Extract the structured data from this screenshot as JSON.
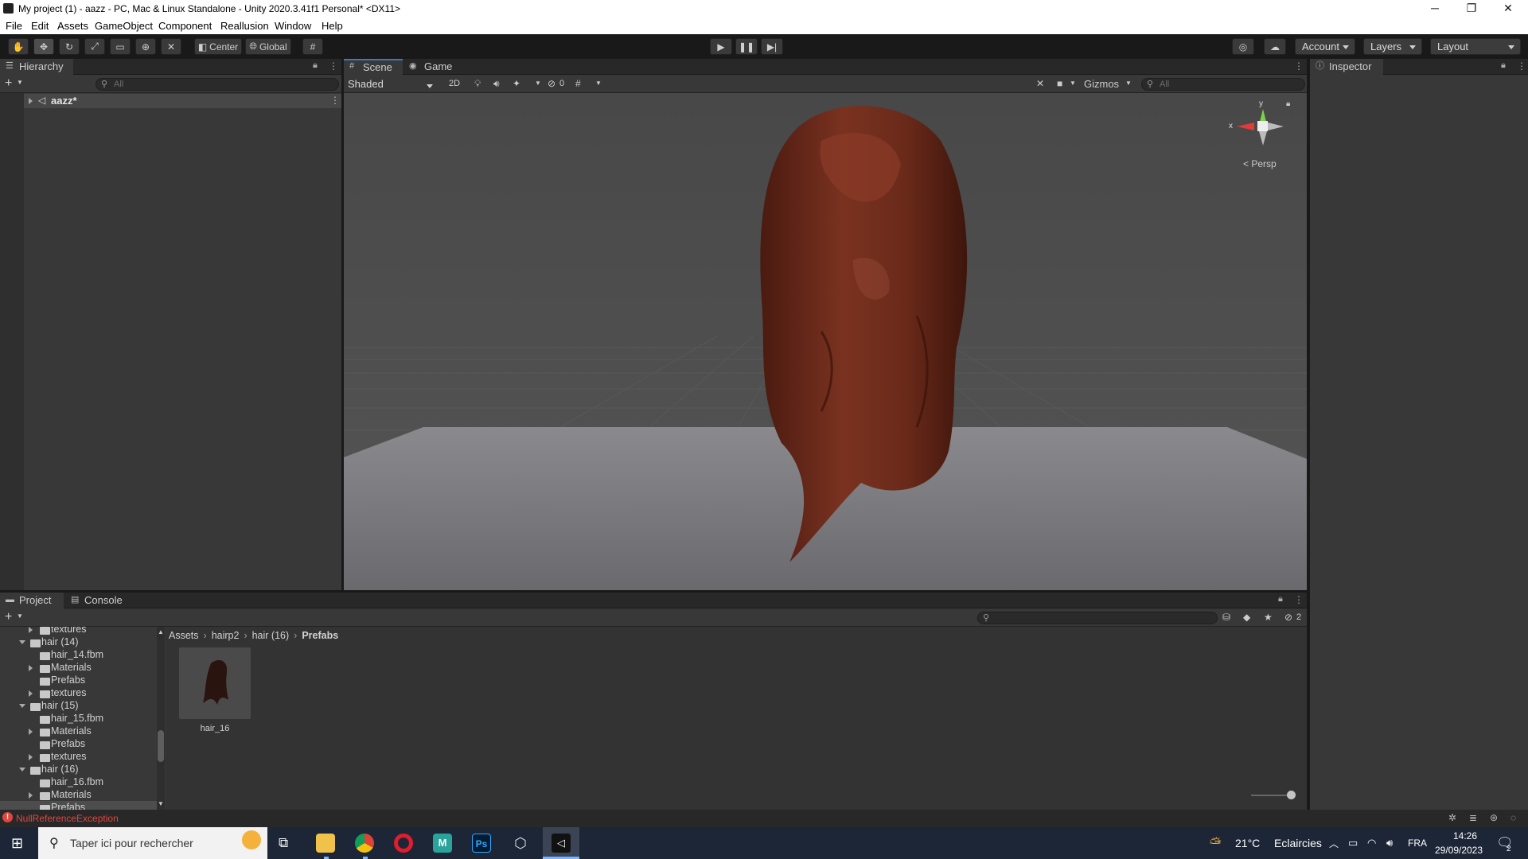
{
  "window": {
    "title": "My project (1) - aazz - PC, Mac & Linux Standalone - Unity 2020.3.41f1 Personal* <DX11>",
    "minimize": "─",
    "maximize": "❐",
    "close": "✕"
  },
  "menu": [
    "File",
    "Edit",
    "Assets",
    "GameObject",
    "Component",
    "Reallusion",
    "Window",
    "Help"
  ],
  "toolbar": {
    "pivot": "Center",
    "space": "Global",
    "account": "Account",
    "layers": "Layers",
    "layout": "Layout"
  },
  "hierarchy": {
    "tab": "Hierarchy",
    "search_placeholder": "All",
    "scene": "aazz*"
  },
  "scene": {
    "tabs": [
      "Scene",
      "Game"
    ],
    "draw_mode": "Shaded",
    "mode_2d": "2D",
    "hidden_count": "0",
    "gizmos": "Gizmos",
    "search_placeholder": "All",
    "projection": "Persp",
    "axis_x": "x",
    "axis_y": "y"
  },
  "inspector": {
    "tab": "Inspector"
  },
  "project": {
    "tabs": [
      "Project",
      "Console"
    ],
    "tree": [
      {
        "label": "textures",
        "indent": 2,
        "arrow": "r"
      },
      {
        "label": "hair (14)",
        "indent": 1,
        "arrow": "d",
        "open": true
      },
      {
        "label": "hair_14.fbm",
        "indent": 2,
        "arrow": ""
      },
      {
        "label": "Materials",
        "indent": 2,
        "arrow": "r"
      },
      {
        "label": "Prefabs",
        "indent": 2,
        "arrow": ""
      },
      {
        "label": "textures",
        "indent": 2,
        "arrow": "r"
      },
      {
        "label": "hair (15)",
        "indent": 1,
        "arrow": "d",
        "open": true
      },
      {
        "label": "hair_15.fbm",
        "indent": 2,
        "arrow": ""
      },
      {
        "label": "Materials",
        "indent": 2,
        "arrow": "r"
      },
      {
        "label": "Prefabs",
        "indent": 2,
        "arrow": ""
      },
      {
        "label": "textures",
        "indent": 2,
        "arrow": "r"
      },
      {
        "label": "hair (16)",
        "indent": 1,
        "arrow": "d",
        "open": true
      },
      {
        "label": "hair_16.fbm",
        "indent": 2,
        "arrow": ""
      },
      {
        "label": "Materials",
        "indent": 2,
        "arrow": "r"
      },
      {
        "label": "Prefabs",
        "indent": 2,
        "arrow": "",
        "selected": true
      }
    ],
    "breadcrumb": [
      "Assets",
      "hairp2",
      "hair (16)",
      "Prefabs"
    ],
    "asset": {
      "name": "hair_16"
    },
    "hidden_count": "2"
  },
  "status": {
    "error": "NullReferenceException"
  },
  "taskbar": {
    "search_placeholder": "Taper ici pour rechercher",
    "weather_temp": "21°C",
    "weather_desc": "Eclaircies",
    "lang": "FRA",
    "time": "14:26",
    "date": "29/09/2023",
    "notif_count": "2"
  },
  "colors": {
    "accent": "#3a79bb",
    "error": "#e0453f",
    "hair": "#6b2a1a"
  }
}
